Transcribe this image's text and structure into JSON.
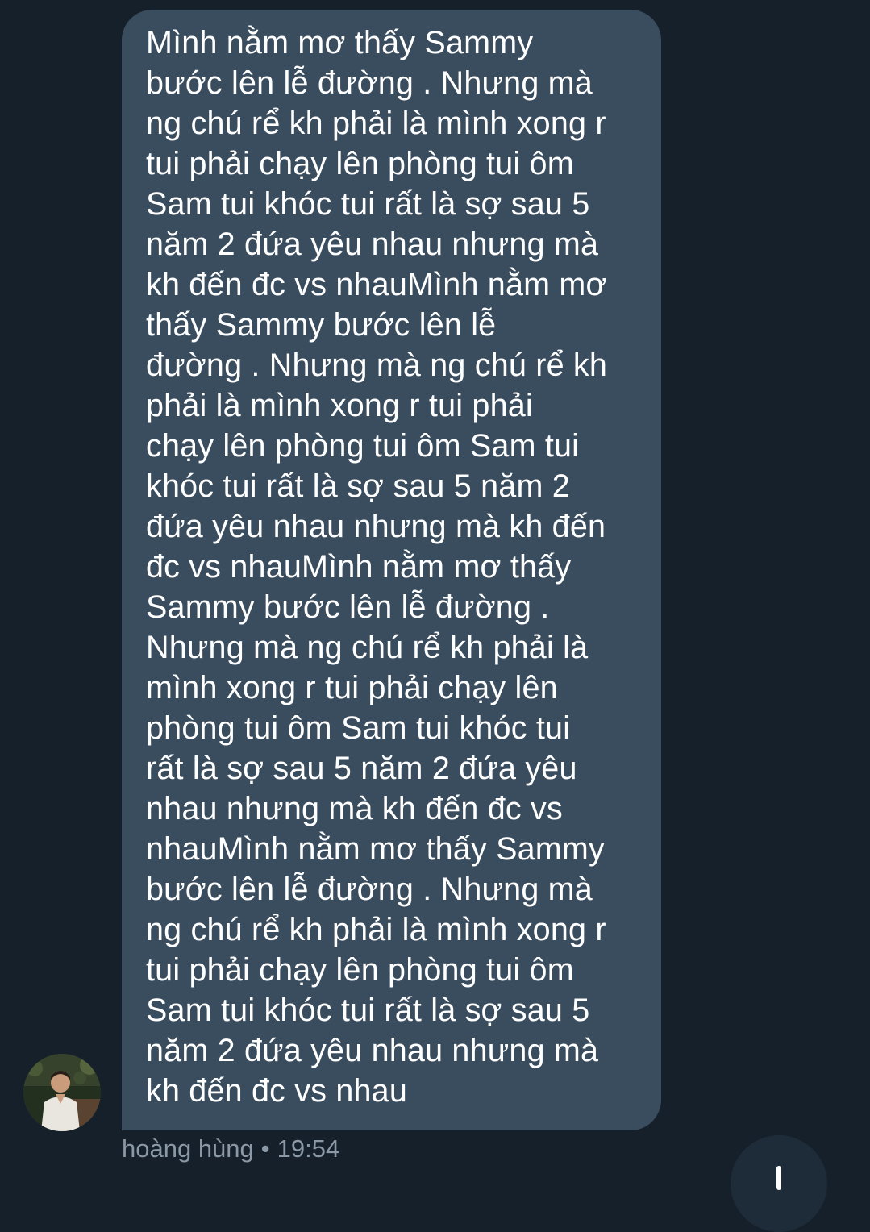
{
  "message": {
    "lines": [
      "Mình nằm mơ thấy Sammy",
      "bước lên lễ đường . Nhưng mà",
      "ng chú rể kh phải là mình xong r",
      "tui phải chạy lên phòng tui ôm",
      "Sam tui khóc tui rất là sợ sau 5",
      "năm 2 đứa yêu nhau nhưng mà",
      "kh đến đc vs nhauMình nằm mơ",
      "thấy Sammy bước lên lễ",
      "đường . Nhưng mà ng chú rể kh",
      "phải là mình xong r tui phải",
      "chạy lên phòng tui ôm Sam tui",
      "khóc tui rất là sợ sau 5 năm 2",
      "đứa yêu nhau nhưng mà kh đến",
      "đc vs nhauMình nằm mơ thấy",
      "Sammy bước lên lễ đường .",
      "Nhưng mà ng chú rể kh phải là",
      "mình xong r tui phải chạy lên",
      "phòng tui ôm Sam tui khóc tui",
      "rất là sợ sau 5 năm 2 đứa yêu",
      "nhau nhưng mà kh đến đc vs",
      "nhauMình nằm mơ thấy Sammy",
      "bước lên lễ đường . Nhưng mà",
      "ng chú rể kh phải là mình xong r",
      "tui phải chạy lên phòng tui ôm",
      "Sam tui khóc tui rất là sợ sau 5",
      "năm 2 đứa yêu nhau nhưng mà",
      "kh đến đc vs nhau"
    ]
  },
  "sender": {
    "name": "hoàng hùng",
    "separator": "•",
    "time": "19:54"
  },
  "colors": {
    "background": "#15202b",
    "bubble": "#3a4d5f",
    "text": "#ffffff",
    "meta": "#8b98a5"
  },
  "icons": {
    "avatar": "user-avatar-photo",
    "fab": "scroll-down-arrow-icon"
  }
}
